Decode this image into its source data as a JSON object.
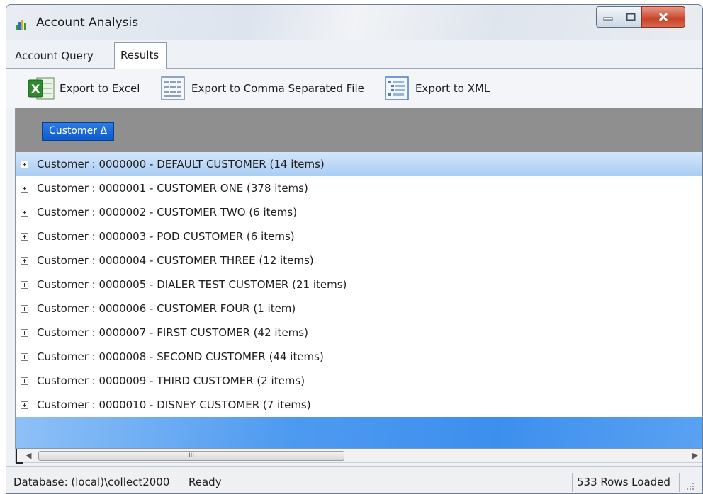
{
  "window": {
    "title": "Account Analysis"
  },
  "tabs": [
    {
      "label": "Account Query"
    },
    {
      "label": "Results"
    }
  ],
  "toolbar": {
    "excel_label": "Export to Excel",
    "csv_label": "Export to Comma Separated File",
    "xml_label": "Export to XML"
  },
  "grid": {
    "group_by": "Customer Δ",
    "rows": [
      "Customer : 0000000 - DEFAULT CUSTOMER (14 items)",
      "Customer : 0000001 - CUSTOMER ONE (378 items)",
      "Customer : 0000002 - CUSTOMER TWO (6 items)",
      "Customer : 0000003 - POD CUSTOMER (6 items)",
      "Customer : 0000004 - CUSTOMER THREE (12 items)",
      "Customer : 0000005 - DIALER TEST CUSTOMER (21 items)",
      "Customer : 0000006 - CUSTOMER FOUR (1 item)",
      "Customer : 0000007 - FIRST CUSTOMER (42 items)",
      "Customer : 0000008 - SECOND CUSTOMER (44 items)",
      "Customer : 0000009 - THIRD CUSTOMER (2 items)",
      "Customer : 0000010 - DISNEY CUSTOMER (7 items)"
    ]
  },
  "scrollbar": {
    "thumb_label": "III"
  },
  "status": {
    "database": "Database: (local)\\collect2000",
    "state": "Ready",
    "rows_loaded": "533 Rows Loaded"
  },
  "colors": {
    "accent": "#0e5ccd",
    "selection": "#a9cdf4",
    "band": "#4d9af0"
  },
  "icons": [
    "chart-icon",
    "minimize-icon",
    "maximize-icon",
    "close-icon",
    "excel-icon",
    "csv-file-icon",
    "xml-file-icon",
    "expand-icon"
  ]
}
